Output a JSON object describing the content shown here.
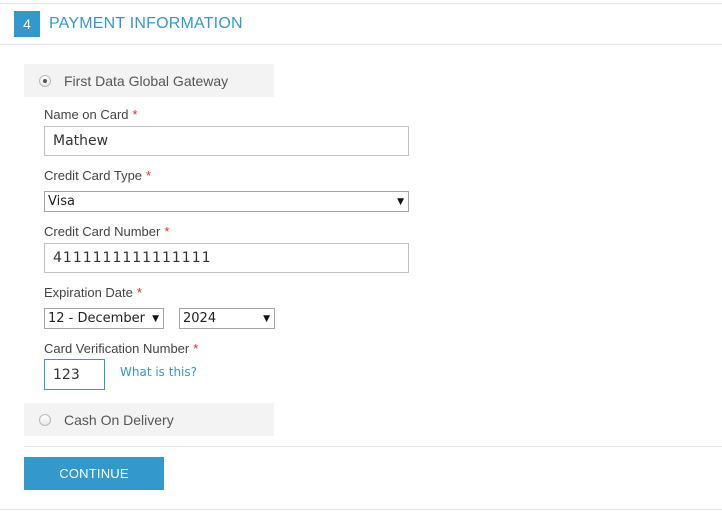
{
  "section": {
    "step_number": "4",
    "title": "PAYMENT INFORMATION"
  },
  "payment_methods": [
    {
      "label": "First Data Global Gateway",
      "selected": true
    },
    {
      "label": "Cash On Delivery",
      "selected": false
    }
  ],
  "form": {
    "name_on_card": {
      "label": "Name on Card",
      "required_mark": "*",
      "value": "Mathew"
    },
    "card_type": {
      "label": "Credit Card Type",
      "required_mark": "*",
      "value": "Visa"
    },
    "card_number": {
      "label": "Credit Card Number",
      "required_mark": "*",
      "value": "4111111111111111"
    },
    "expiration": {
      "label": "Expiration Date",
      "required_mark": "*",
      "month": "12 - December",
      "year": "2024"
    },
    "cvv": {
      "label": "Card Verification Number",
      "required_mark": "*",
      "value": "123",
      "help_link": "What is this?"
    }
  },
  "actions": {
    "continue_label": "CONTINUE"
  },
  "icons": {
    "dropdown_arrow": "▼"
  },
  "colors": {
    "accent": "#3399cc",
    "required": "#e02b27"
  }
}
